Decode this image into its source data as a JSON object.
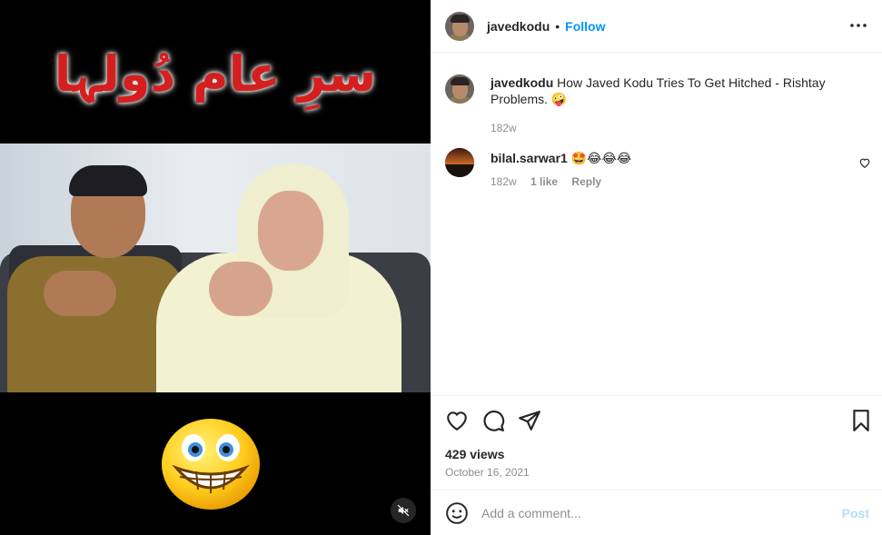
{
  "media": {
    "title_urdu": "سرِ عام دُولہا",
    "mute_icon": "speaker-muted-icon",
    "emoji_icon": "grinning-face-emoji"
  },
  "post": {
    "author": {
      "username": "javedkodu",
      "separator": "•",
      "follow_label": "Follow"
    },
    "caption": {
      "username": "javedkodu",
      "text": " How Javed Kodu Tries To Get Hitched - Rishtay Problems. 🤪",
      "time": "182w"
    },
    "comments": [
      {
        "username": "bilal.sarwar1",
        "text": " 🤩😂😂😂",
        "time": "182w",
        "likes": "1 like",
        "reply_label": "Reply"
      }
    ],
    "views": "429 views",
    "date": "October 16, 2021",
    "add_comment": {
      "placeholder": "Add a comment...",
      "post_label": "Post"
    }
  },
  "colors": {
    "follow": "#0095f6",
    "post_disabled": "#b2dffc",
    "muted_text": "#8e8e8e"
  }
}
